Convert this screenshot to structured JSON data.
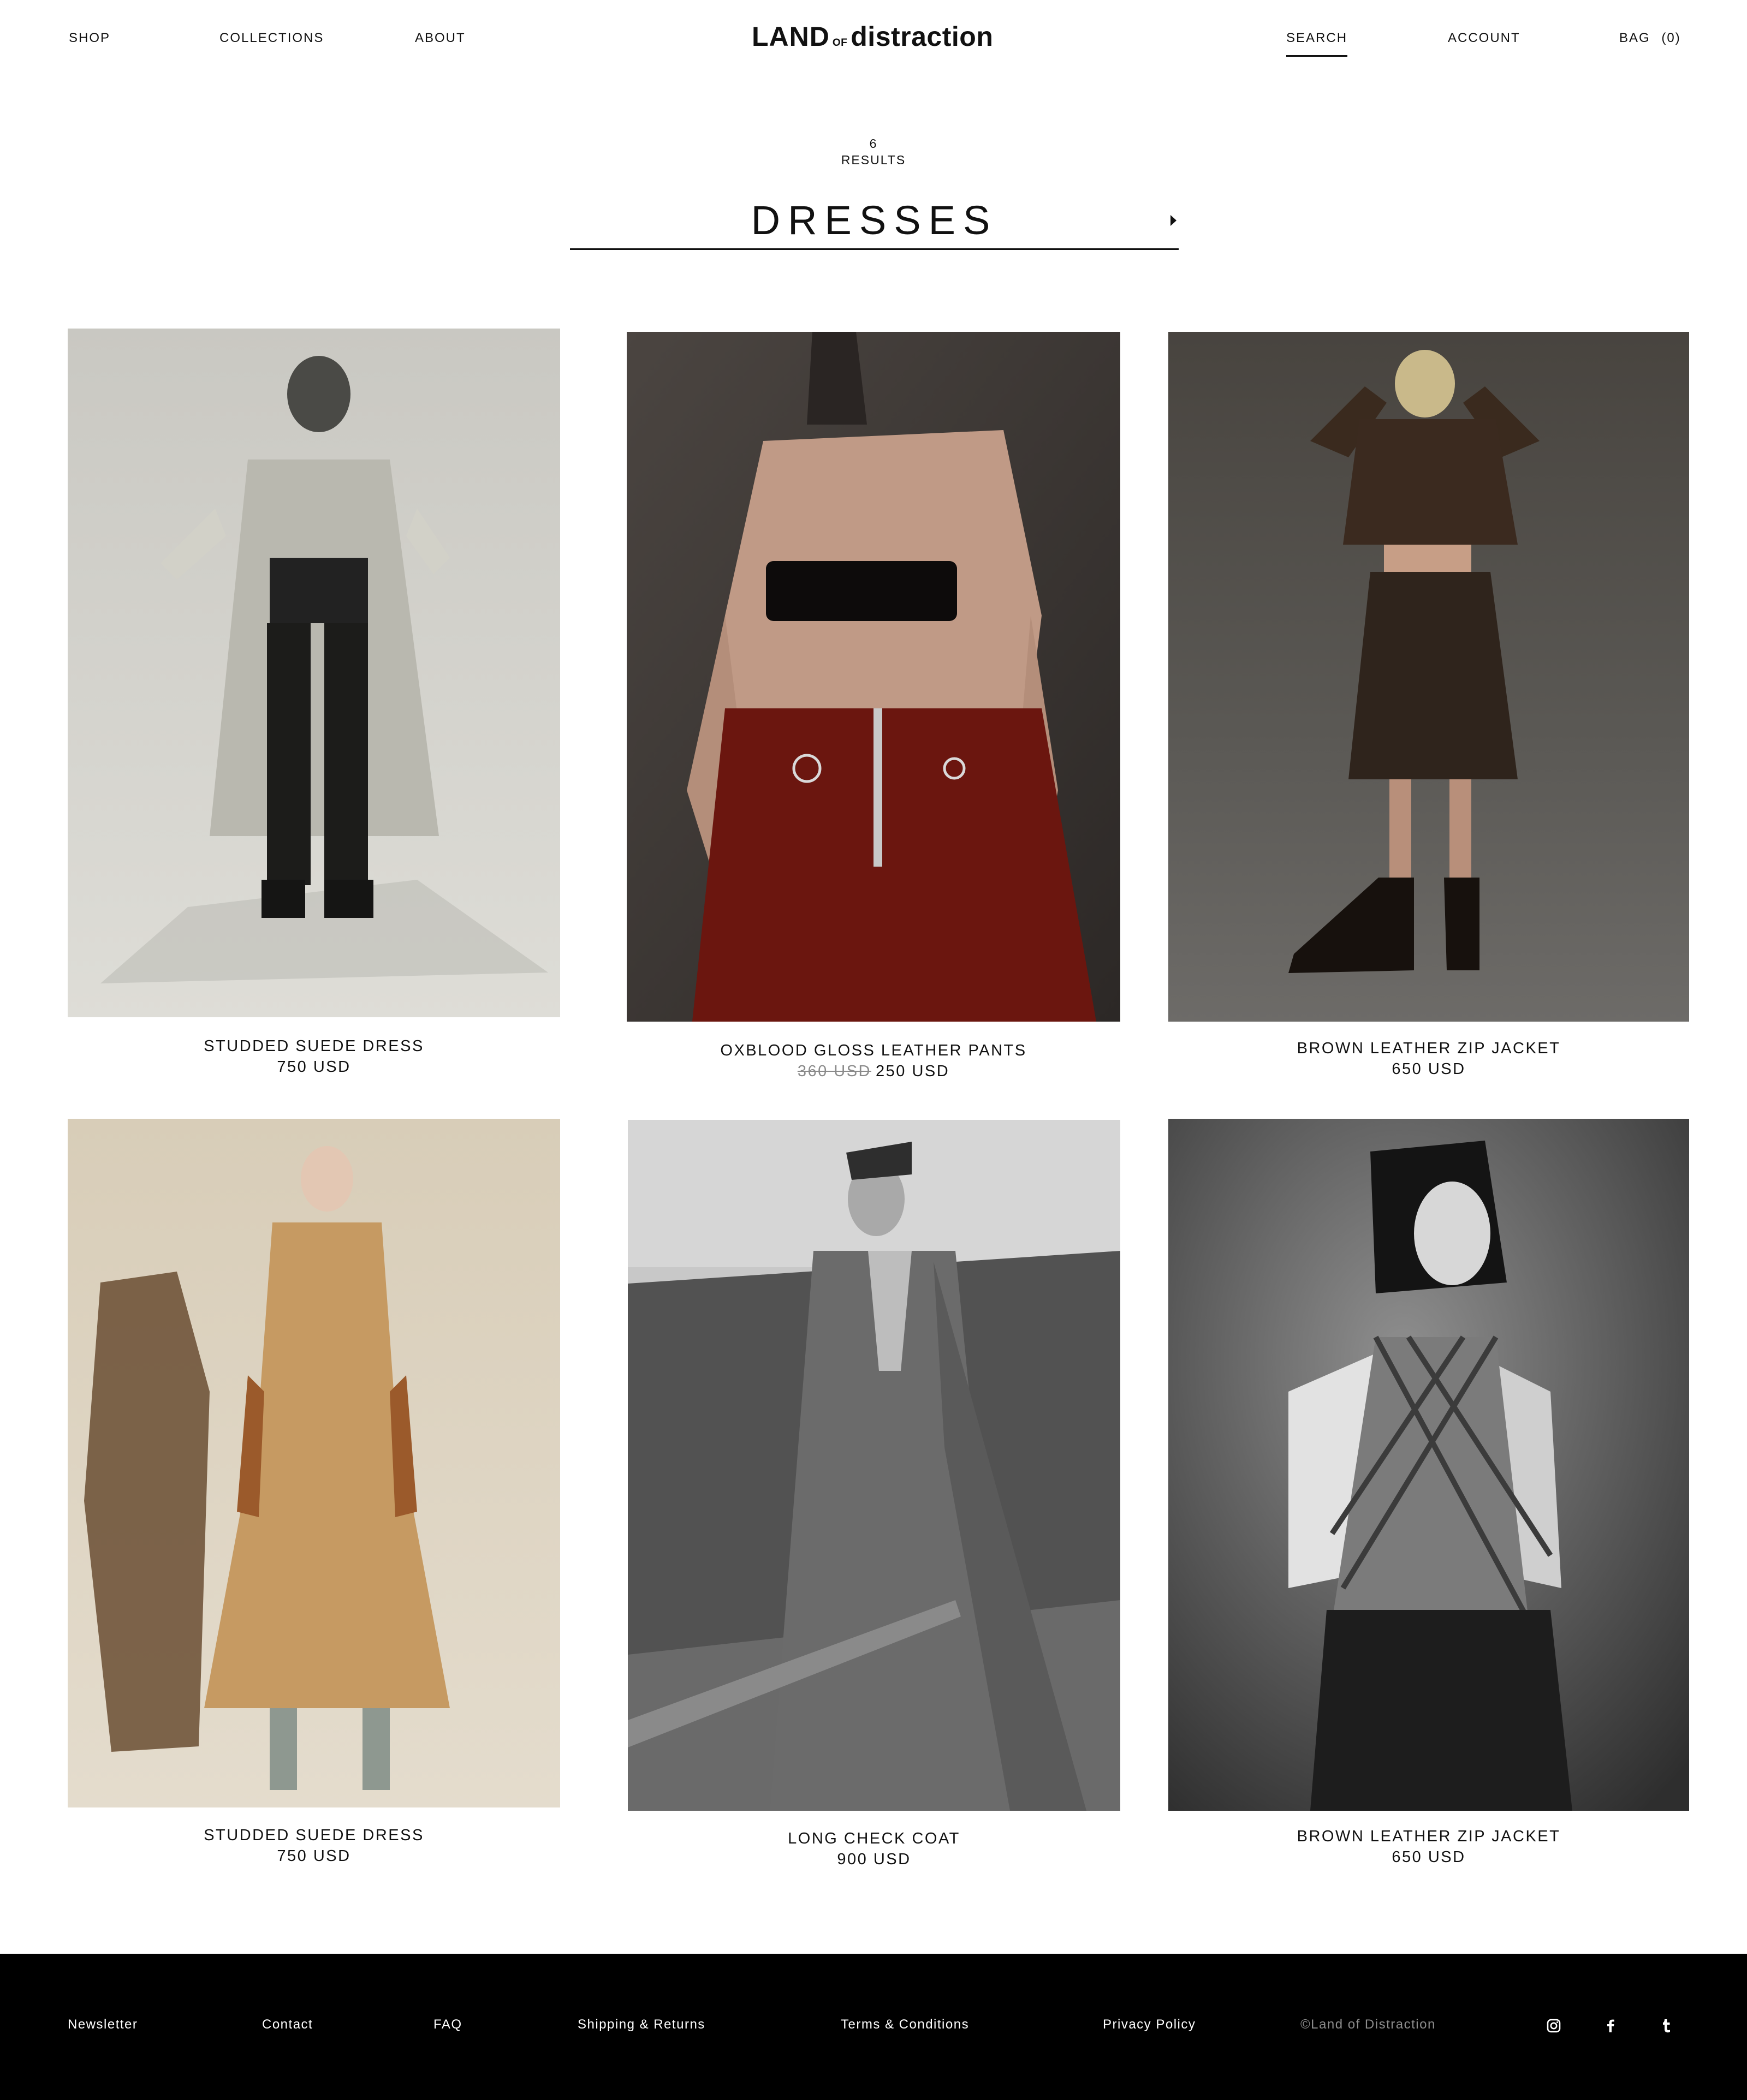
{
  "colors": {
    "text": "#111111",
    "background": "#ffffff",
    "footer_background": "#000000",
    "footer_text": "#ffffff",
    "muted": "#8a8a8a"
  },
  "header": {
    "nav_left": [
      "SHOP",
      "COLLECTIONS",
      "ABOUT"
    ],
    "logo": {
      "main": "LAND",
      "small": "OF",
      "tail": "distraction"
    },
    "search_label": "SEARCH",
    "account_label": "ACCOUNT",
    "bag_label": "BAG",
    "bag_count": "(0)"
  },
  "listing": {
    "results_count": "6",
    "results_label": "RESULTS",
    "category": "DRESSES",
    "category_arrow_icon": "caret-right-icon"
  },
  "products": [
    {
      "name": "STUDDED SUEDE DRESS",
      "price": "750 USD"
    },
    {
      "name": "OXBLOOD GLOSS LEATHER PANTS",
      "old_price": "360 USD",
      "price": "250 USD"
    },
    {
      "name": "BROWN LEATHER ZIP JACKET",
      "price": "650 USD"
    },
    {
      "name": "STUDDED SUEDE DRESS",
      "price": "750 USD"
    },
    {
      "name": "LONG CHECK COAT",
      "price": "900 USD"
    },
    {
      "name": "BROWN LEATHER ZIP JACKET",
      "price": "650 USD"
    }
  ],
  "footer": {
    "links": [
      "Newsletter",
      "Contact",
      "FAQ",
      "Shipping & Returns",
      "Terms & Conditions",
      "Privacy Policy"
    ],
    "copyright": "©Land of Distraction",
    "social_icons": [
      "instagram-icon",
      "facebook-icon",
      "tumblr-icon"
    ]
  }
}
